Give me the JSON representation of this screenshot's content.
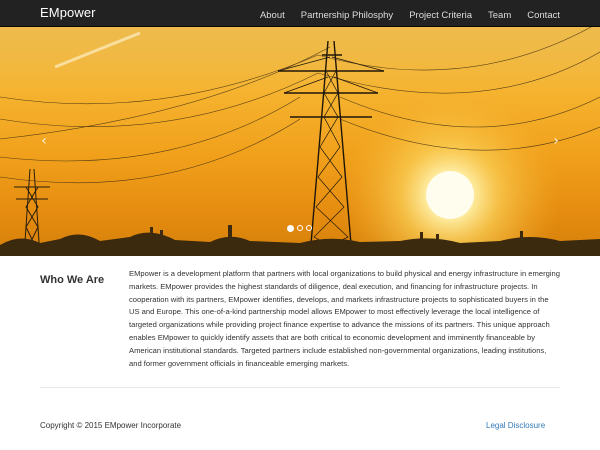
{
  "navbar": {
    "brand": "EMpower",
    "links": [
      "About",
      "Partnership Philosphy",
      "Project Criteria",
      "Team",
      "Contact"
    ]
  },
  "hero": {
    "prev_glyph": "‹",
    "next_glyph": "›",
    "slide_count": 3,
    "active_slide": 1,
    "colors": {
      "sky_top": "#f4c54e",
      "sky_bottom": "#d5800b",
      "sun": "#fffbe0"
    }
  },
  "who": {
    "title": "Who We Are",
    "text": "EMpower is a development platform that partners with local organizations to build physical and energy infrastructure in emerging markets. EMpower provides the highest standards of diligence, deal execution, and financing for infrastructure projects. In cooperation with its partners, EMpower identifies, develops, and markets infrastructure projects to sophisticated buyers in the US and Europe. This one-of-a-kind partnership model allows EMpower to most effectively leverage the local intelligence of targeted organizations while providing project finance expertise to advance the missions of its partners. This unique approach enables EMpower to quickly identify assets that are both critical to economic development and imminently financeable by American institutional standards. Targeted partners include established non-governmental organizations, leading institutions, and former government officials in financeable emerging markets."
  },
  "footer": {
    "copyright": "Copyright © 2015 EMpower Incorporate",
    "legal": "Legal Disclosure"
  },
  "colors": {
    "navbar_bg": "#222222",
    "link": "#337ab7"
  }
}
